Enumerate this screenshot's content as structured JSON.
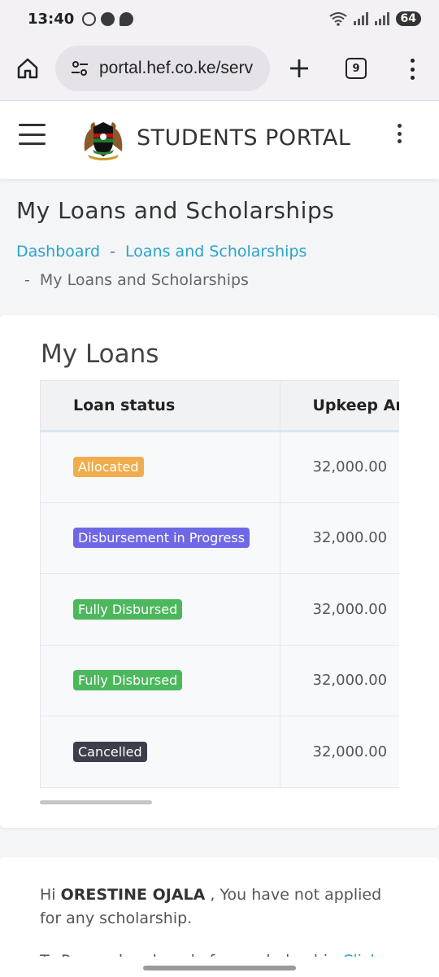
{
  "status_bar": {
    "time": "13:40",
    "battery": "64"
  },
  "browser": {
    "url": "portal.hef.co.ke/serv",
    "tab_count": "9"
  },
  "app_header": {
    "title": "STUDENTS PORTAL"
  },
  "page": {
    "title": "My Loans and Scholarships",
    "breadcrumb": {
      "items": [
        "Dashboard",
        "Loans and Scholarships"
      ],
      "current": "My Loans and Scholarships",
      "separator": "-"
    }
  },
  "loans": {
    "title": "My Loans",
    "columns": [
      "Loan status",
      "Upkeep Am"
    ],
    "rows": [
      {
        "status": "Allocated",
        "status_color": "#f0ad4e",
        "amount": "32,000.00"
      },
      {
        "status": "Disbursement in Progress",
        "status_color": "#6f68e6",
        "amount": "32,000.00"
      },
      {
        "status": "Fully Disbursed",
        "status_color": "#4cb85c",
        "amount": "32,000.00"
      },
      {
        "status": "Fully Disbursed",
        "status_color": "#4cb85c",
        "amount": "32,000.00"
      },
      {
        "status": "Cancelled",
        "status_color": "#3b3f4b",
        "amount": "32,000.00"
      }
    ]
  },
  "scholarship": {
    "greeting": "Hi",
    "name": "ORESTINE OJALA",
    "message": ", You have not applied for any scholarship.",
    "next_line": "To Proceed and apply for a scholarship",
    "link": "Click"
  },
  "colors": {
    "link": "#2aa3c8"
  }
}
